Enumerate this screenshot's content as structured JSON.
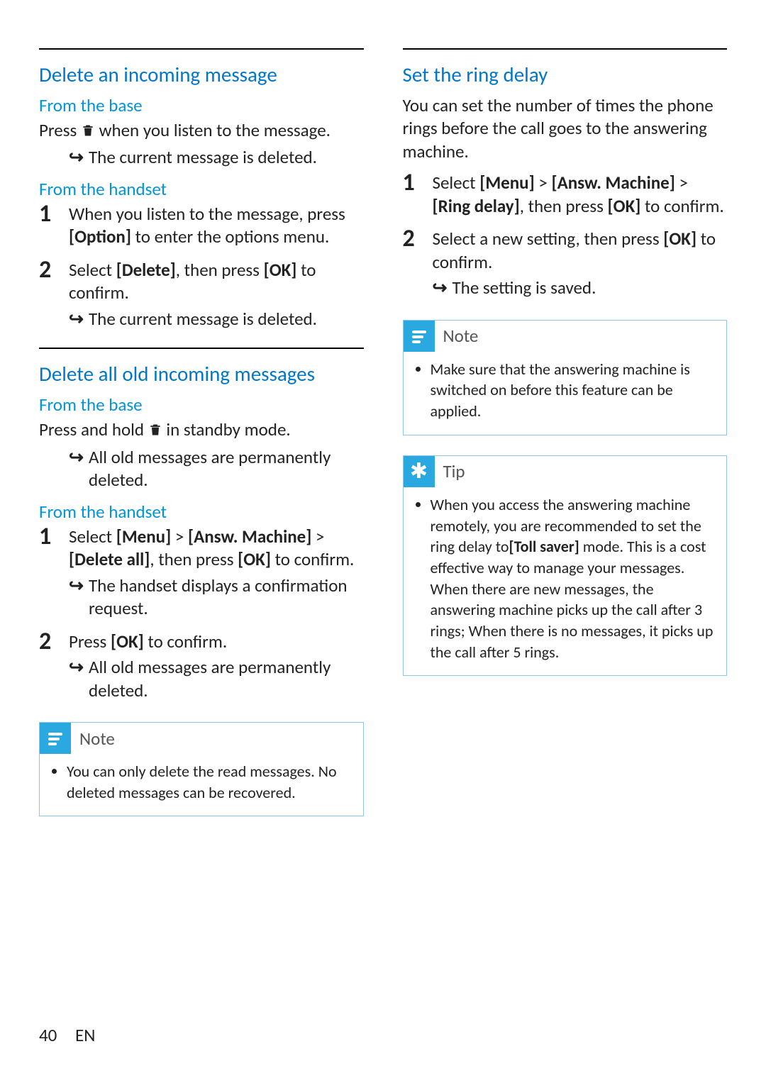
{
  "left": {
    "sec1": {
      "heading": "Delete an incoming message",
      "sub1": "From the base",
      "p1a": "Press ",
      "p1b": " when you listen to the message.",
      "r1": "The current message is deleted.",
      "sub2": "From the handset",
      "step1a": "When you listen to the message, press ",
      "step1b": "[Option]",
      "step1c": " to enter the options menu.",
      "step2a": "Select ",
      "step2b": "[Delete]",
      "step2c": ", then press ",
      "step2d": "[OK]",
      "step2e": " to confirm.",
      "r2": "The current message is deleted."
    },
    "sec2": {
      "heading": "Delete all old incoming messages",
      "sub1": "From the base",
      "p1a": "Press and hold ",
      "p1b": " in standby mode.",
      "r1": "All old messages are permanently deleted.",
      "sub2": "From the handset",
      "step1a": "Select ",
      "step1b": "[Menu]",
      "step1c": " > ",
      "step1d": "[Answ. Machine]",
      "step1e": " > ",
      "step1f": "[Delete all]",
      "step1g": ", then press ",
      "step1h": "[OK]",
      "step1i": " to confirm.",
      "r2": "The handset displays a confirmation request.",
      "step2a": "Press ",
      "step2b": "[OK]",
      "step2c": " to confirm.",
      "r3": "All old messages are permanently deleted."
    },
    "note": {
      "title": "Note",
      "text": "You can only delete the read messages. No deleted messages can be recovered."
    }
  },
  "right": {
    "sec1": {
      "heading": "Set the ring delay",
      "intro": "You can set the number of times the phone rings before the call goes to the answering machine.",
      "step1a": "Select ",
      "step1b": "[Menu]",
      "step1c": " > ",
      "step1d": "[Answ. Machine]",
      "step1e": " > ",
      "step1f": "[Ring delay]",
      "step1g": ", then press ",
      "step1h": "[OK]",
      "step1i": " to confirm.",
      "step2a": "Select a new setting, then press ",
      "step2b": "[OK]",
      "step2c": " to confirm.",
      "r1": "The setting is saved."
    },
    "note": {
      "title": "Note",
      "text": "Make sure that the answering machine is switched on before this feature can be applied."
    },
    "tip": {
      "title": "Tip",
      "t1": "When you access the answering machine remotely, you are recommended to set the ring delay to",
      "t2": "[Toll saver]",
      "t3": " mode. This is a cost effective way to manage your messages. When there are new messages, the answering machine picks up the call after 3 rings; When there is no messages, it picks up the call after 5 rings."
    }
  },
  "footer": {
    "page": "40",
    "lang": "EN"
  }
}
